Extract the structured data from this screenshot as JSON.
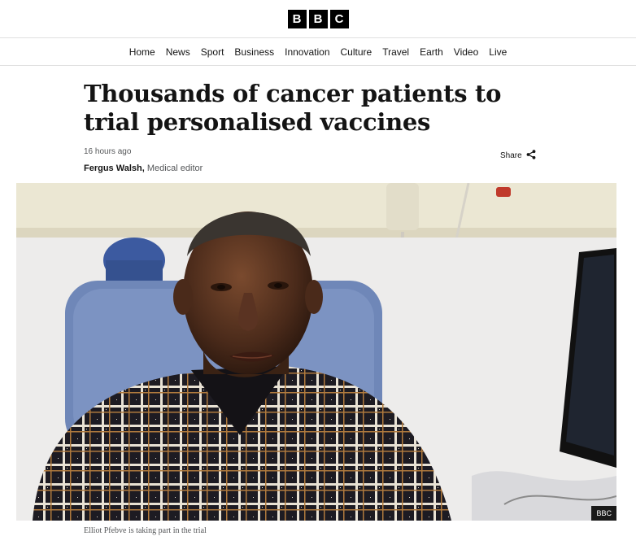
{
  "brand": {
    "letters": [
      "B",
      "B",
      "C"
    ]
  },
  "nav": {
    "items": [
      "Home",
      "News",
      "Sport",
      "Business",
      "Innovation",
      "Culture",
      "Travel",
      "Earth",
      "Video",
      "Live"
    ]
  },
  "article": {
    "headline": "Thousands of cancer patients to trial personalised vaccines",
    "timestamp": "16 hours ago",
    "author": "Fergus Walsh,",
    "author_role": "Medical editor",
    "share_label": "Share",
    "share_icon": "share-icon",
    "image_credit": "BBC",
    "image_caption": "Elliot Pfebve is taking part in the trial"
  }
}
